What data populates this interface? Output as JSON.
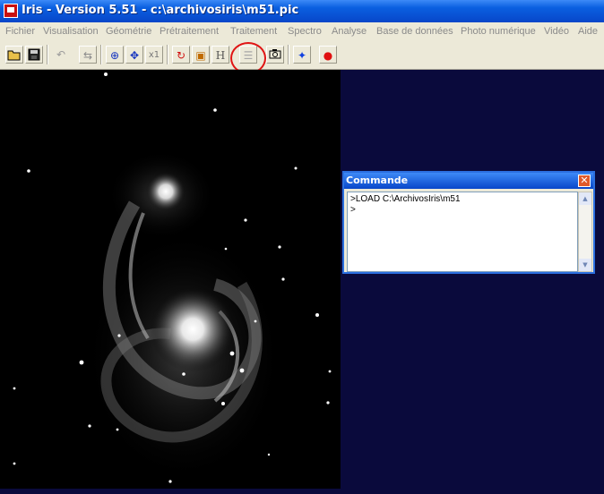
{
  "window": {
    "title": "Iris - Version 5.51 - c:\\archivosiris\\m51.pic",
    "app_icon": "iris-app-icon"
  },
  "menu": [
    "Fichier",
    "Visualisation",
    "Géométrie",
    "Prétraitement",
    "Traitement",
    "Spectro",
    "Analyse",
    "Base de données",
    "Photo numérique",
    "Vidéo",
    "Aide"
  ],
  "toolbar": {
    "buttons": [
      {
        "name": "open-folder-icon",
        "glyph": "📂"
      },
      {
        "name": "save-disk-icon",
        "glyph": "💾"
      },
      {
        "name": "undo-icon",
        "glyph": "↶"
      },
      {
        "name": "swap-icon",
        "glyph": "⇆"
      },
      {
        "name": "crosshair-zoom-icon",
        "glyph": "⊕"
      },
      {
        "name": "move-arrows-icon",
        "glyph": "✥"
      },
      {
        "name": "zoom-x1-icon",
        "label": "x1"
      },
      {
        "name": "spiral-icon",
        "glyph": "↻"
      },
      {
        "name": "image-frame-icon",
        "glyph": "▣"
      },
      {
        "name": "histogram-h-icon",
        "label": "H"
      },
      {
        "name": "command-console-icon",
        "glyph": "☰"
      },
      {
        "name": "camera-icon",
        "glyph": "📷"
      },
      {
        "name": "blue-star-icon",
        "glyph": "✦"
      },
      {
        "name": "red-dot-icon",
        "glyph": "●"
      }
    ]
  },
  "command_window": {
    "title": "Commande",
    "lines": [
      ">LOAD C:\\ArchivosIris\\m51",
      ">"
    ]
  },
  "colors": {
    "titlebar": "#0a5fe0",
    "workspace": "#0a0a3c",
    "highlight": "#e01414"
  }
}
